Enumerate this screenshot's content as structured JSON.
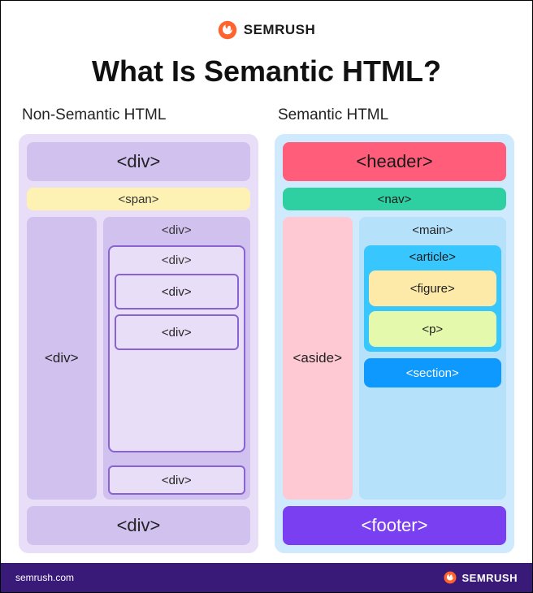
{
  "brand": "SEMRUSH",
  "title": "What Is Semantic HTML?",
  "columns": {
    "left": {
      "heading": "Non-Semantic HTML",
      "header_box": "<div>",
      "span_box": "<span>",
      "side_div": "<div>",
      "main_div_label": "<div>",
      "inner_group_label": "<div>",
      "inner_div_1": "<div>",
      "inner_div_2": "<div>",
      "lower_div": "<div>",
      "footer_div": "<div>"
    },
    "right": {
      "heading": "Semantic HTML",
      "header": "<header>",
      "nav": "<nav>",
      "aside": "<aside>",
      "main": "<main>",
      "article": "<article>",
      "figure": "<figure>",
      "p": "<p>",
      "section": "<section>",
      "footer": "<footer>"
    }
  },
  "footer_url": "semrush.com",
  "footer_brand": "SEMRUSH",
  "colors": {
    "brand_orange": "#ff642e",
    "footer_purple": "#3a1a78"
  }
}
